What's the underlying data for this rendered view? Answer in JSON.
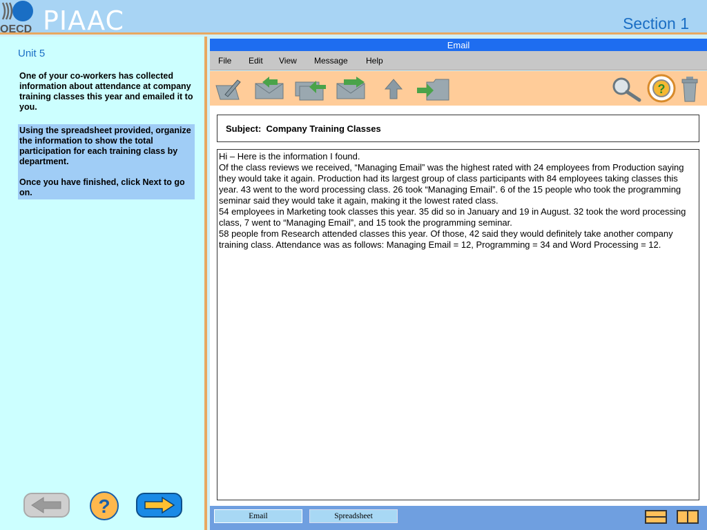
{
  "header": {
    "logo_text": "OECD",
    "brand": "PIAAC",
    "section": "Section 1"
  },
  "left": {
    "unit": "Unit 5",
    "intro": "One of your co-workers has collected information about attendance at company training classes this year and emailed it to you.",
    "task_para1": "Using the spreadsheet provided, organize the information to show the total participation for each training class by department.",
    "task_para2": "Once you have finished, click Next to go on."
  },
  "email": {
    "title": "Email",
    "menu": [
      "File",
      "Edit",
      "View",
      "Message",
      "Help"
    ],
    "subject_label": "Subject:",
    "subject_value": "Company Training Classes",
    "body_lines": [
      "Hi – Here is the information I found.",
      "Of the class reviews we received, “Managing Email” was the highest rated with 24 employees from Production saying they would take it again.  Production had its largest group of class participants with 84 employees taking classes this year.  43 went to the word processing class.  26 took “Managing Email”.   6 of the 15 people who took the programming seminar said they would take it again, making it the lowest rated class.",
      "54 employees in Marketing took classes this year.  35 did so in January and 19 in August.  32 took the word processing class, 7 went to “Managing Email”, and 15 took the programming seminar.",
      "58 people from Research attended classes this year.  Of those, 42 said they would definitely take another company training class.  Attendance was as follows:  Managing Email = 12, Programming = 34 and Word Processing = 12."
    ]
  },
  "taskbar": {
    "email_label": "Email",
    "spreadsheet_label": "Spreadsheet"
  },
  "colors": {
    "header_bg": "#a8d4f4",
    "left_panel_bg": "#ccffff",
    "accent_orange": "#e8a860",
    "title_blue": "#1e6df0",
    "toolbar_bg": "#ffcc99"
  }
}
